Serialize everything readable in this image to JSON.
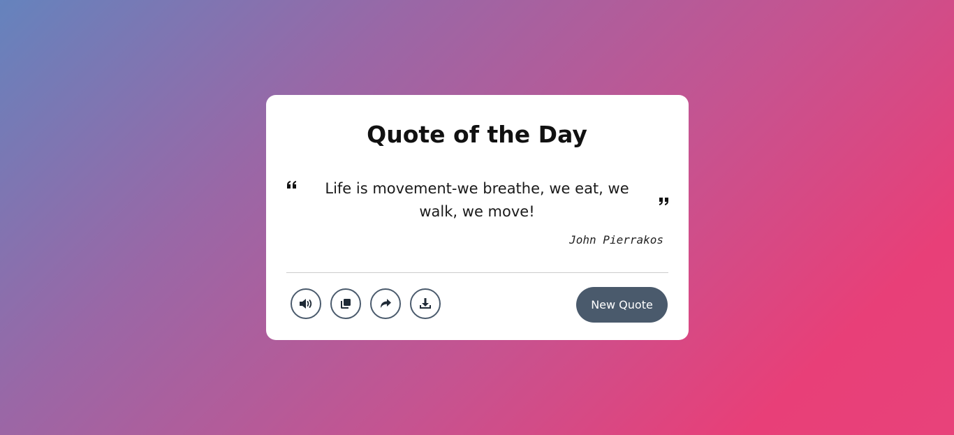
{
  "card": {
    "title": "Quote of the Day",
    "quote": "Life is movement-we breathe, we eat, we walk, we move!",
    "author": "John Pierrakos"
  },
  "actions": {
    "speak_icon": "volume-icon",
    "copy_icon": "copy-icon",
    "share_icon": "share-icon",
    "download_icon": "download-icon",
    "new_quote_label": "New Quote"
  },
  "colors": {
    "button": "#4a5a6c",
    "card": "#ffffff",
    "gradient_start": "#6583bd",
    "gradient_end": "#e8427a"
  }
}
